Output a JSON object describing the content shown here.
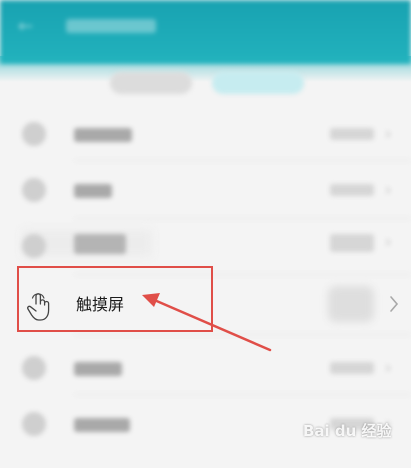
{
  "main_item": {
    "label": "触摸屏"
  },
  "watermark": {
    "text": "Bai du 经验"
  },
  "icons": {
    "back": "back-arrow-icon",
    "touch": "touch-hand-icon",
    "chevron": "chevron-right-icon"
  },
  "annotation": {
    "box_color": "#e04e48",
    "arrow_color": "#e04e48"
  },
  "colors": {
    "header": "#1aa6b4",
    "background": "#f4f4f4"
  }
}
